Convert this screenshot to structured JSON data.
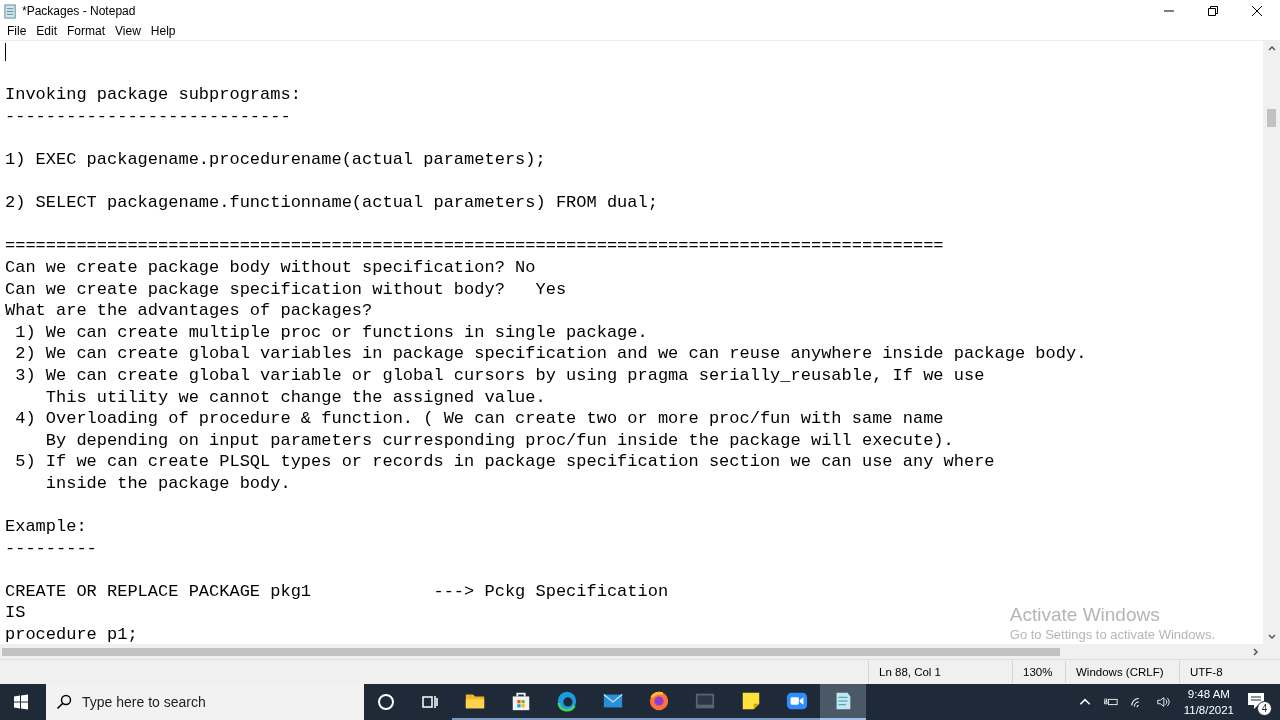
{
  "window": {
    "title": "*Packages - Notepad"
  },
  "menu": [
    "File",
    "Edit",
    "Format",
    "View",
    "Help"
  ],
  "editor": {
    "lines": [
      {
        "kind": "cursor"
      },
      {
        "kind": "blank"
      },
      {
        "kind": "text",
        "text": "Invoking package subprograms:"
      },
      {
        "kind": "text",
        "text": "----------------------------"
      },
      {
        "kind": "blank"
      },
      {
        "kind": "text",
        "text": "1) EXEC packagename.procedurename(actual parameters);"
      },
      {
        "kind": "blank"
      },
      {
        "kind": "text",
        "text": "2) SELECT packagename.functionname(actual parameters) FROM dual;"
      },
      {
        "kind": "blank"
      },
      {
        "kind": "text",
        "text": "============================================================================================"
      },
      {
        "kind": "text",
        "text": "Can we create package body without specification? No"
      },
      {
        "kind": "text",
        "text": "Can we create package specification without body?   Yes"
      },
      {
        "kind": "text",
        "text": "What are the advantages of packages?"
      },
      {
        "kind": "text",
        "text": " 1) We can create multiple proc or functions in single package."
      },
      {
        "kind": "text",
        "text": " 2) We can create global variables in package specification and we can reuse anywhere inside package body."
      },
      {
        "kind": "text",
        "text": " 3) We can create global variable or global cursors by using pragma serially_reusable, If we use"
      },
      {
        "kind": "text",
        "text": "    This utility we cannot change the assigned value."
      },
      {
        "kind": "text",
        "text": " 4) Overloading of procedure & function. ( We can create two or more proc/fun with same name"
      },
      {
        "kind": "text",
        "text": "    By depending on input parameters curresponding proc/fun inside the package will execute)."
      },
      {
        "kind": "text",
        "text": " 5) If we can create PLSQL types or records in package specification section we can use any where"
      },
      {
        "kind": "text",
        "text": "    inside the package body."
      },
      {
        "kind": "blank"
      },
      {
        "kind": "text",
        "text": "Example:"
      },
      {
        "kind": "text",
        "text": "---------"
      },
      {
        "kind": "blank"
      },
      {
        "kind": "text",
        "text": "CREATE OR REPLACE PACKAGE pkg1            ---> Pckg Specification"
      },
      {
        "kind": "text",
        "text": "IS"
      },
      {
        "kind": "text",
        "text": "procedure p1;"
      }
    ]
  },
  "activation_notice": {
    "title": "Activate Windows",
    "subtitle": "Go to Settings to activate Windows."
  },
  "status_bar": [
    "Ln 88, Col 1",
    "130%",
    "Windows (CRLF)",
    "UTF-8"
  ],
  "taskbar": {
    "search": {
      "placeholder": "Type here to search"
    },
    "apps": [
      {
        "kind": "explorer",
        "selected": false
      },
      {
        "kind": "store",
        "selected": false
      },
      {
        "kind": "edge",
        "selected": false
      },
      {
        "kind": "mail",
        "selected": false
      },
      {
        "kind": "firefox",
        "selected": false
      },
      {
        "kind": "terminal",
        "selected": false
      },
      {
        "kind": "sticky",
        "selected": false
      },
      {
        "kind": "zoom",
        "selected": false
      },
      {
        "kind": "notepad",
        "selected": true
      }
    ],
    "time": "9:48 AM",
    "date": "11/8/2021",
    "notifications": "4"
  }
}
